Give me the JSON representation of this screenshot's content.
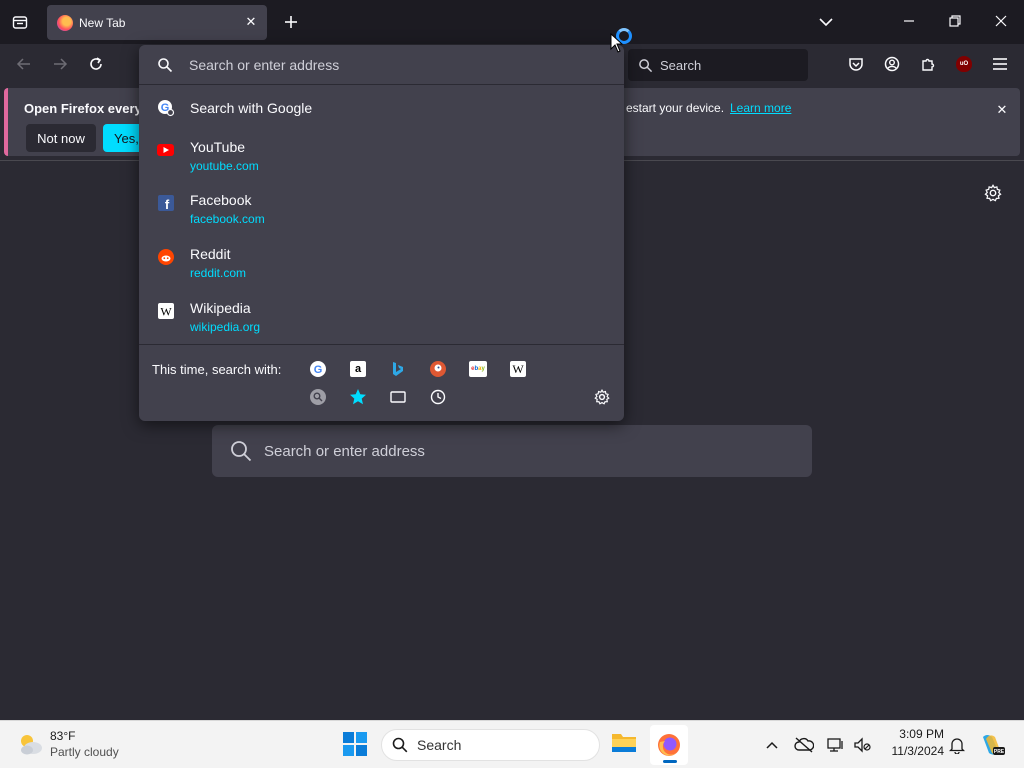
{
  "tab": {
    "title": "New Tab",
    "icon": "firefox-icon"
  },
  "toolbar": {
    "search_placeholder": "Search"
  },
  "notification": {
    "message": "Open Firefox every ti",
    "message_tail": "estart your device.",
    "learn_more": "Learn more",
    "not_now": "Not now",
    "yes": "Yes, o"
  },
  "urlbar": {
    "placeholder": "Search or enter address",
    "search_with": "Search with Google",
    "suggestions": [
      {
        "name": "YouTube",
        "url": "youtube.com",
        "icon": "youtube-icon"
      },
      {
        "name": "Facebook",
        "url": "facebook.com",
        "icon": "facebook-icon"
      },
      {
        "name": "Reddit",
        "url": "reddit.com",
        "icon": "reddit-icon"
      },
      {
        "name": "Wikipedia",
        "url": "wikipedia.org",
        "icon": "wikipedia-icon"
      }
    ],
    "one_off_label": "This time, search with:",
    "engines": [
      "google-icon",
      "amazon-icon",
      "bing-icon",
      "duckduckgo-icon",
      "ebay-icon",
      "wikipedia-icon"
    ],
    "modes": [
      "search-engine-icon",
      "bookmarks-star-icon",
      "tabs-icon",
      "history-clock-icon"
    ]
  },
  "content": {
    "search_placeholder": "Search or enter address"
  },
  "taskbar": {
    "weather_temp": "83°F",
    "weather_condition": "Partly cloudy",
    "search_placeholder": "Search",
    "time": "3:09 PM",
    "date": "11/3/2024"
  },
  "colors": {
    "accent": "#00ddff",
    "popup_bg": "#42414d",
    "page_bg": "#2b2a33"
  }
}
